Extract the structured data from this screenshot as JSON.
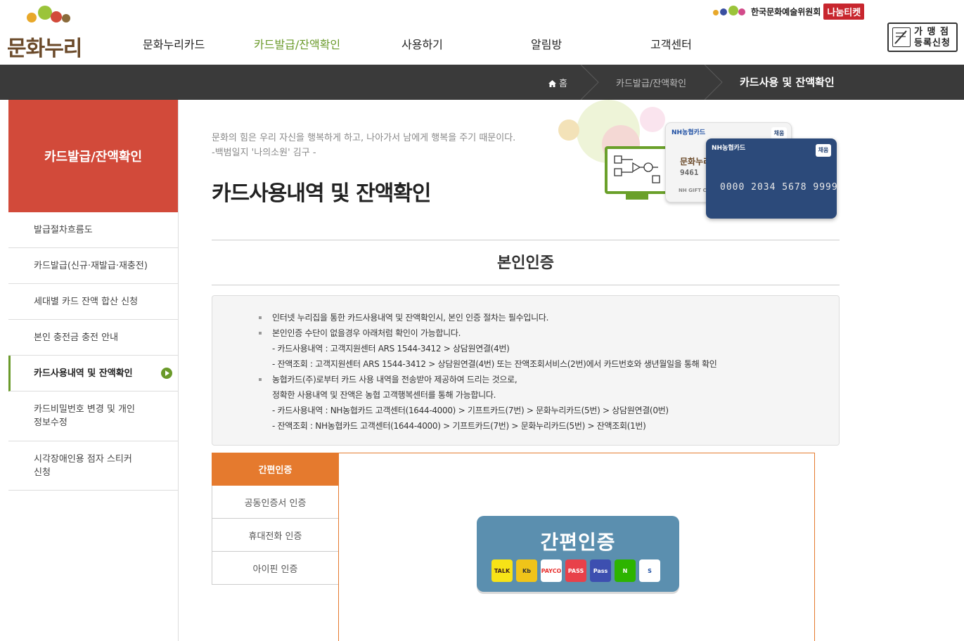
{
  "header": {
    "logo_text": "문화누리",
    "nav": [
      "문화누리카드",
      "카드발급/잔액확인",
      "사용하기",
      "알림방",
      "고객센터"
    ],
    "partner_name": "한국문화예술위원회",
    "nanum_ticket": "나눔티켓",
    "merchant_line1": "가 맹 점",
    "merchant_line2": "등록신청"
  },
  "breadcrumb": {
    "home": "홈",
    "level1": "카드발급/잔액확인",
    "current": "카드사용 및 잔액확인"
  },
  "sidebar": {
    "title": "카드발급/잔액확인",
    "items": [
      {
        "line1": "발급절차흐름도",
        "line2": ""
      },
      {
        "line1": "카드발급(신규·재발급·재충전)",
        "line2": ""
      },
      {
        "line1": "세대별 카드 잔액 합산 신청",
        "line2": ""
      },
      {
        "line1": "본인 충전금 충전 안내",
        "line2": ""
      },
      {
        "line1": "카드사용내역 및 잔액확인",
        "line2": ""
      },
      {
        "line1": "카드비밀번호 변경 및 개인",
        "line2": "정보수정"
      },
      {
        "line1": "시각장애인용 점자 스티커",
        "line2": "신청"
      }
    ]
  },
  "main": {
    "quote_line1": "문화의 힘은 우리 자신을 행복하게 하고, 나아가서 남에게 행복을 주기 때문이다.",
    "quote_line2": "-백범일지 '나의소원' 김구 -",
    "page_title": "카드사용내역 및 잔액확인",
    "section_title": "본인인증",
    "card_white_brand": "NH농협카드",
    "card_white_logo": "문화누리",
    "card_white_num": "9461",
    "card_white_sub": "NH GIFT CA",
    "card_blue_brand": "NH농협카드",
    "card_blue_number": "0000 2034 5678 9999",
    "card_chip": "채움",
    "info": [
      "인터넷 누리집을 통한 카드사용내역 및 잔액확인시, 본인 인증 절차는 필수입니다.",
      "본인인증 수단이 없을경우 아래처럼 확인이 가능합니다.",
      "- 카드사용내역 : 고객지원센터 ARS 1544-3412 > 상담원연결(4번)",
      "- 잔액조회 : 고객지원센터 ARS 1544-3412 > 상담원연결(4번) 또는 잔액조회서비스(2번)에서 카드번호와 생년월일을 통해 확인",
      "농협카드(주)로부터 카드 사용 내역을 전송받아 제공하여 드리는 것으로,",
      "정확한 사용내역 및 잔액은 농협 고객행복센터를 통해 가능합니다.",
      "- 카드사용내역 : NH농협카드 고객센터(1644-4000) > 기프트카드(7번) > 문화누리카드(5번) > 상담원연결(0번)",
      "- 잔액조회 : NH농협카드 고객센터(1644-4000) > 기프트카드(7번) > 문화누리카드(5번) > 잔액조회(1번)"
    ]
  },
  "auth": {
    "tabs": [
      "간편인증",
      "공동인증서 인증",
      "휴대전화 인증",
      "아이핀 인증"
    ],
    "simple_title": "간편인증",
    "providers": [
      {
        "label": "TALK",
        "bg": "#f7e317",
        "fg": "#3a1d1d"
      },
      {
        "label": "Kb",
        "bg": "#f0c419",
        "fg": "#333"
      },
      {
        "label": "PAYCO",
        "bg": "#ffffff",
        "fg": "#e8312f"
      },
      {
        "label": "PASS",
        "bg": "#e8414a",
        "fg": "#ffffff"
      },
      {
        "label": "Pass",
        "bg": "#3d4fb0",
        "fg": "#ffffff"
      },
      {
        "label": "N",
        "bg": "#2db400",
        "fg": "#ffffff"
      },
      {
        "label": "S",
        "bg": "#ffffff",
        "fg": "#1e4fa3"
      }
    ]
  },
  "colors": {
    "accent_green": "#6a9a2a",
    "sidebar_red": "#d24a3a",
    "auth_orange": "#e57a2e",
    "auth_blue": "#5b8faf"
  }
}
